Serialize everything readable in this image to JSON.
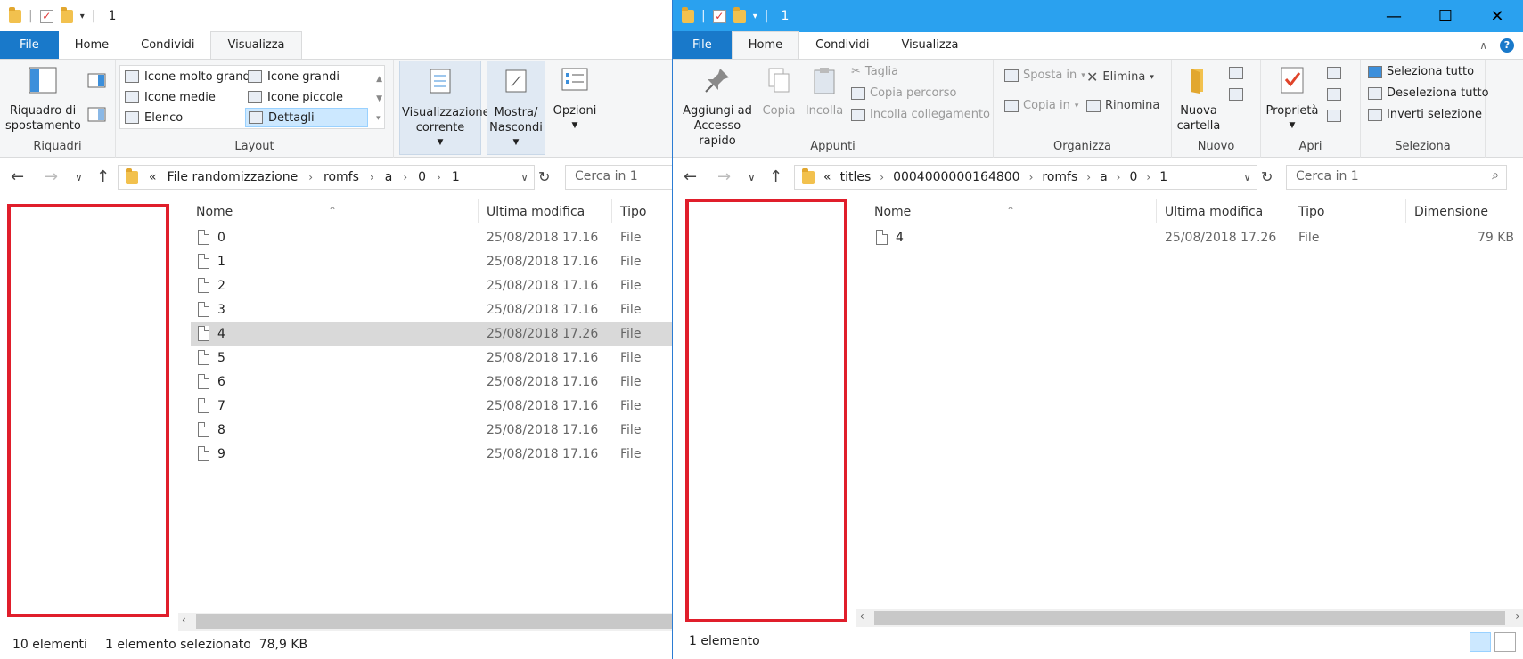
{
  "left": {
    "title": "1",
    "tabs": [
      "File",
      "Home",
      "Condividi",
      "Visualizza"
    ],
    "active_tab": "Visualizza",
    "ribbon": {
      "riquadri": {
        "label": "Riquadri",
        "nav_pane": "Riquadro di spostamento"
      },
      "layout": {
        "label": "Layout",
        "items": [
          "Icone molto grandi",
          "Icone grandi",
          "Icone medie",
          "Icone piccole",
          "Elenco",
          "Dettagli"
        ],
        "selected": "Dettagli"
      },
      "current_view": "Visualizzazione corrente",
      "show_hide": "Mostra/ Nascondi",
      "options": "Opzioni"
    },
    "path": [
      "«",
      "File randomizzazione",
      "romfs",
      "a",
      "0",
      "1"
    ],
    "search_placeholder": "Cerca in 1",
    "columns": [
      "Nome",
      "Ultima modifica",
      "Tipo"
    ],
    "files": [
      {
        "name": "0",
        "date": "25/08/2018 17.16",
        "type": "File"
      },
      {
        "name": "1",
        "date": "25/08/2018 17.16",
        "type": "File"
      },
      {
        "name": "2",
        "date": "25/08/2018 17.16",
        "type": "File"
      },
      {
        "name": "3",
        "date": "25/08/2018 17.16",
        "type": "File"
      },
      {
        "name": "4",
        "date": "25/08/2018 17.26",
        "type": "File",
        "selected": true
      },
      {
        "name": "5",
        "date": "25/08/2018 17.16",
        "type": "File"
      },
      {
        "name": "6",
        "date": "25/08/2018 17.16",
        "type": "File"
      },
      {
        "name": "7",
        "date": "25/08/2018 17.16",
        "type": "File"
      },
      {
        "name": "8",
        "date": "25/08/2018 17.16",
        "type": "File"
      },
      {
        "name": "9",
        "date": "25/08/2018 17.16",
        "type": "File"
      }
    ],
    "status": {
      "count": "10 elementi",
      "selection": "1 elemento selezionato  78,9 KB"
    }
  },
  "right": {
    "title": "1",
    "tabs": [
      "File",
      "Home",
      "Condividi",
      "Visualizza"
    ],
    "active_tab": "Home",
    "ribbon": {
      "pin": "Aggiungi ad Accesso rapido",
      "copy": "Copia",
      "paste": "Incolla",
      "cut": "Taglia",
      "copy_path": "Copia percorso",
      "paste_shortcut": "Incolla collegamento",
      "appunti": "Appunti",
      "move_to": "Sposta in",
      "copy_to": "Copia in",
      "delete": "Elimina",
      "rename": "Rinomina",
      "organizza": "Organizza",
      "new_folder": "Nuova cartella",
      "nuovo": "Nuovo",
      "properties": "Proprietà",
      "apri": "Apri",
      "select_all": "Seleziona tutto",
      "select_none": "Deseleziona tutto",
      "invert": "Inverti selezione",
      "seleziona": "Seleziona"
    },
    "path": [
      "«",
      "titles",
      "0004000000164800",
      "romfs",
      "a",
      "0",
      "1"
    ],
    "search_placeholder": "Cerca in 1",
    "columns": [
      "Nome",
      "Ultima modifica",
      "Tipo",
      "Dimensione"
    ],
    "files": [
      {
        "name": "4",
        "date": "25/08/2018 17.26",
        "type": "File",
        "size": "79 KB"
      }
    ],
    "status": {
      "count": "1 elemento"
    }
  },
  "colors": {
    "accent": "#1979ca",
    "titlebar_active": "#2aa1ef",
    "highlight": "#e01e2b",
    "selected_row": "#d9d9d9"
  }
}
